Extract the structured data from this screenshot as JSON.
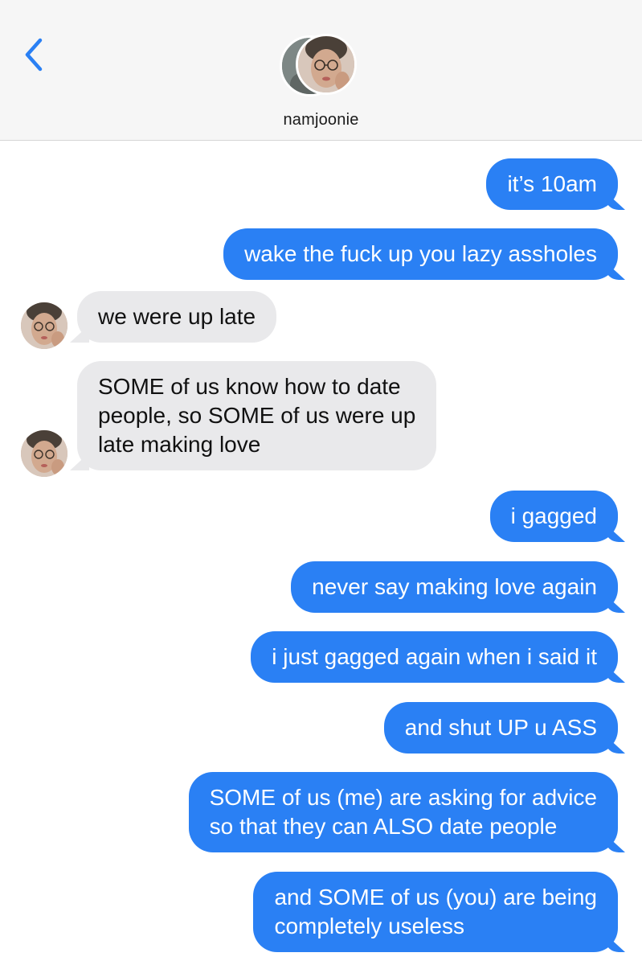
{
  "header": {
    "contact_name": "namjoonie",
    "back_icon": "chevron-left-icon",
    "accent_color": "#2a80f4"
  },
  "messages": [
    {
      "direction": "out",
      "lines": [
        "it’s 10am"
      ]
    },
    {
      "direction": "out",
      "lines": [
        "wake the fuck up you lazy assholes"
      ]
    },
    {
      "direction": "in",
      "lines": [
        "we were up late"
      ]
    },
    {
      "direction": "in",
      "lines": [
        "SOME of us know how to date",
        "people, so SOME of us were up",
        "late making love"
      ]
    },
    {
      "direction": "out",
      "lines": [
        "i gagged"
      ]
    },
    {
      "direction": "out",
      "lines": [
        "never say making love again"
      ]
    },
    {
      "direction": "out",
      "lines": [
        "i just gagged again when i said it"
      ]
    },
    {
      "direction": "out",
      "lines": [
        "and shut UP u ASS"
      ]
    },
    {
      "direction": "out",
      "lines": [
        "SOME of us (me) are asking for advice",
        "so that they can ALSO date people"
      ]
    },
    {
      "direction": "out",
      "lines": [
        "and SOME of us (you) are being",
        "completely useless"
      ]
    }
  ],
  "colors": {
    "outgoing_bubble": "#2a80f4",
    "incoming_bubble": "#e9e9eb",
    "header_bg": "#f6f6f6"
  }
}
